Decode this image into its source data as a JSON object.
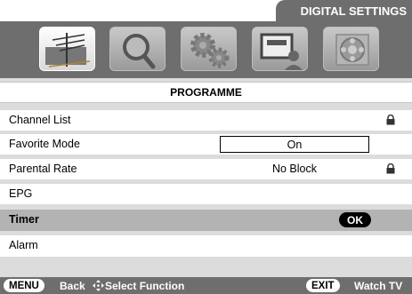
{
  "header": {
    "title": "DIGITAL SETTINGS"
  },
  "icons": [
    {
      "name": "antenna-programme-icon",
      "active": true
    },
    {
      "name": "magnifier-icon",
      "active": false
    },
    {
      "name": "gears-icon",
      "active": false
    },
    {
      "name": "screen-user-icon",
      "active": false
    },
    {
      "name": "film-reel-icon",
      "active": false
    }
  ],
  "section": {
    "title": "PROGRAMME"
  },
  "menu": [
    {
      "label": "Channel List",
      "value": "",
      "locked": true
    },
    {
      "label": "Favorite Mode",
      "value": "On",
      "locked": false
    },
    {
      "label": "Parental Rate",
      "value": "No Block",
      "locked": true
    },
    {
      "label": "EPG",
      "value": "",
      "locked": false
    },
    {
      "label": "Timer",
      "value": "OK",
      "selected": true
    },
    {
      "label": "Alarm",
      "value": "",
      "locked": false
    }
  ],
  "footer": {
    "menu_key": "MENU",
    "back_label": "Back",
    "select_label": "Select Function",
    "exit_key": "EXIT",
    "watch_label": "Watch TV"
  }
}
